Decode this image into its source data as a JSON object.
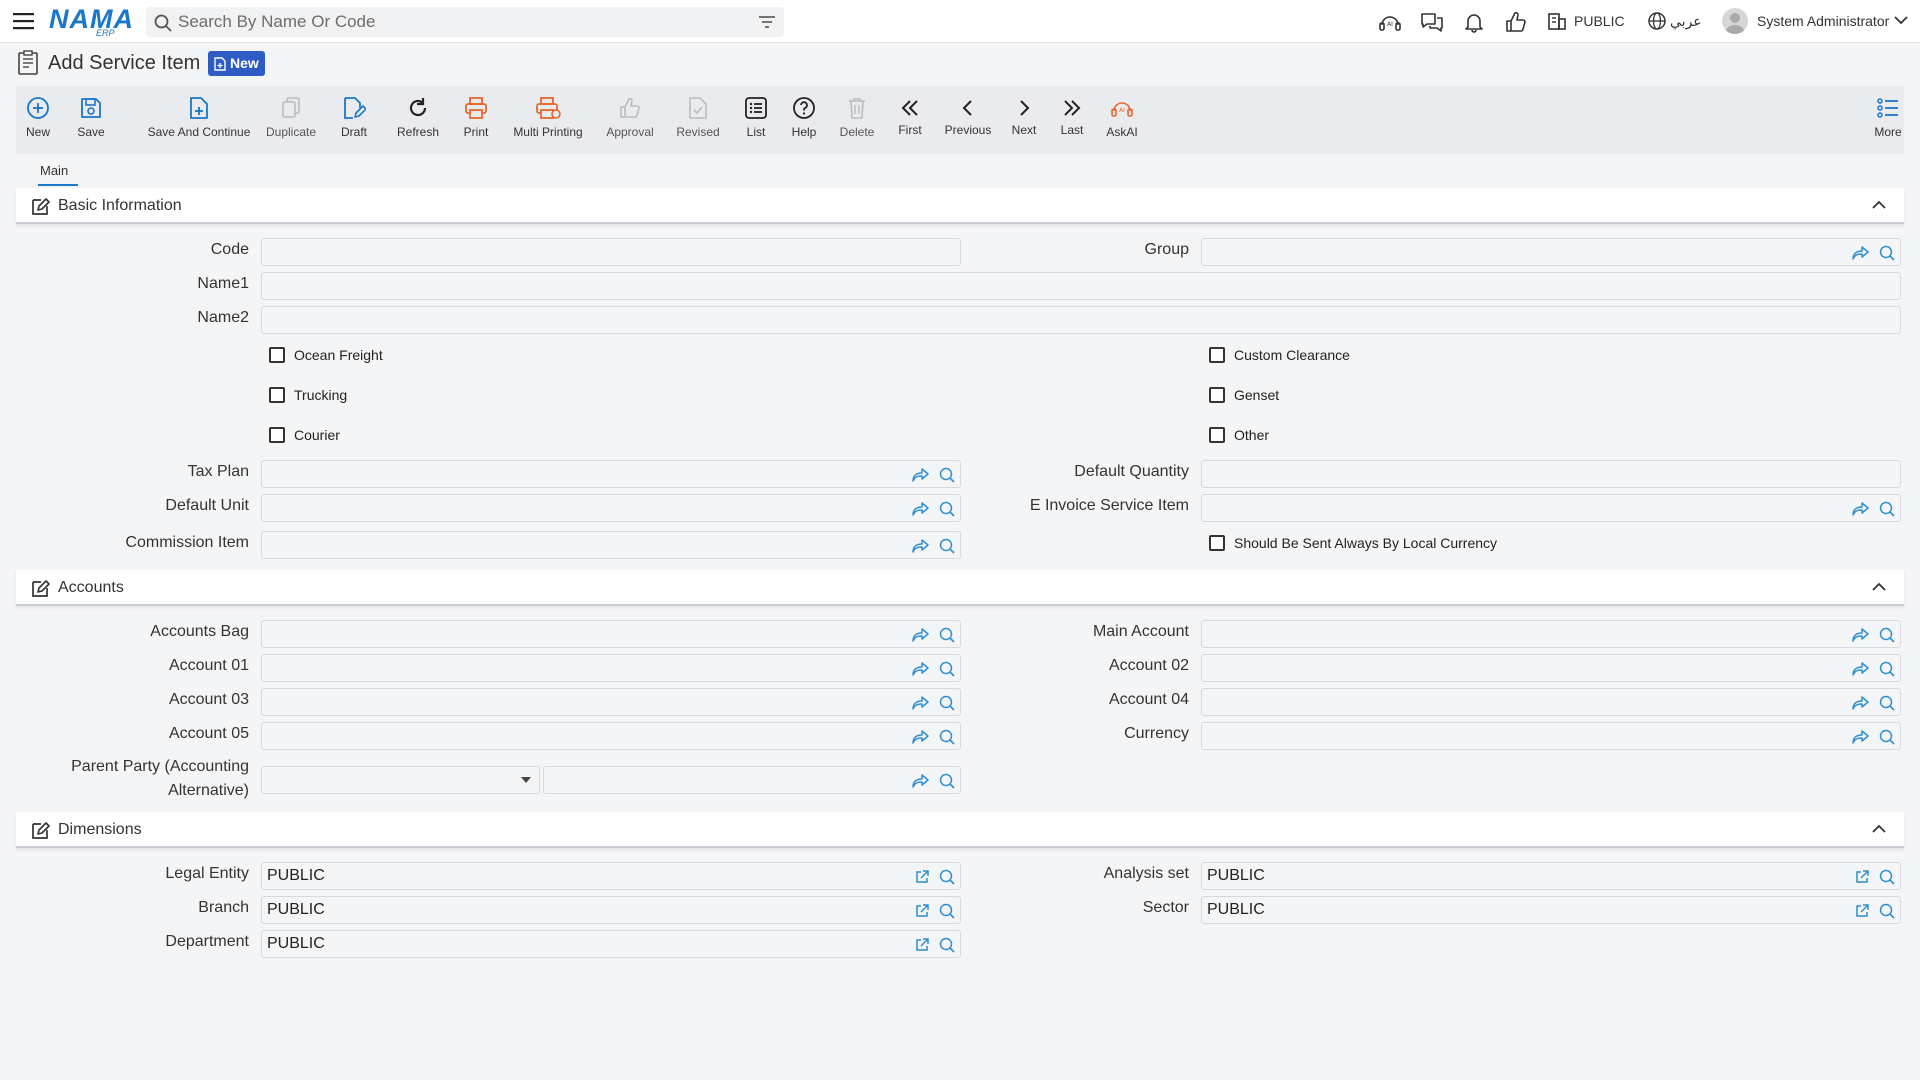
{
  "topbar": {
    "logo_main": "NAMA",
    "logo_sub": "ERP",
    "search_placeholder": "Search By Name Or Code",
    "entity": "PUBLIC",
    "language": "عربي",
    "user": "System Administrator"
  },
  "page": {
    "title": "Add Service Item",
    "badge": "New"
  },
  "toolbar": {
    "new": "New",
    "save": "Save",
    "save_continue": "Save And Continue",
    "duplicate": "Duplicate",
    "draft": "Draft",
    "refresh": "Refresh",
    "print": "Print",
    "multi_printing": "Multi Printing",
    "approval": "Approval",
    "revised": "Revised",
    "list": "List",
    "help": "Help",
    "delete": "Delete",
    "first": "First",
    "previous": "Previous",
    "next": "Next",
    "last": "Last",
    "askai": "AskAI",
    "more": "More"
  },
  "tabs": {
    "main": "Main"
  },
  "basic": {
    "title": "Basic Information",
    "code": "Code",
    "group": "Group",
    "name1": "Name1",
    "name2": "Name2",
    "ocean_freight": "Ocean Freight",
    "trucking": "Trucking",
    "courier": "Courier",
    "custom_clearance": "Custom Clearance",
    "genset": "Genset",
    "other": "Other",
    "tax_plan": "Tax Plan",
    "default_unit": "Default Unit",
    "commission_item": "Commission Item",
    "default_quantity": "Default Quantity",
    "e_invoice_service_item": "E Invoice Service Item",
    "local_currency": "Should Be Sent Always By Local Currency"
  },
  "accounts": {
    "title": "Accounts",
    "accounts_bag": "Accounts Bag",
    "account_01": "Account 01",
    "account_03": "Account 03",
    "account_05": "Account 05",
    "parent_party_line1": "Parent Party (Accounting",
    "parent_party_line2": "Alternative)",
    "main_account": "Main Account",
    "account_02": "Account 02",
    "account_04": "Account 04",
    "currency": "Currency"
  },
  "dimensions": {
    "title": "Dimensions",
    "legal_entity": "Legal Entity",
    "legal_entity_value": "PUBLIC",
    "branch": "Branch",
    "branch_value": "PUBLIC",
    "department": "Department",
    "department_value": "PUBLIC",
    "analysis_set": "Analysis set",
    "analysis_set_value": "PUBLIC",
    "sector": "Sector",
    "sector_value": "PUBLIC"
  },
  "colors": {
    "accent": "#1a77c9",
    "badge": "#2f5bc4",
    "print": "#e8682a"
  }
}
